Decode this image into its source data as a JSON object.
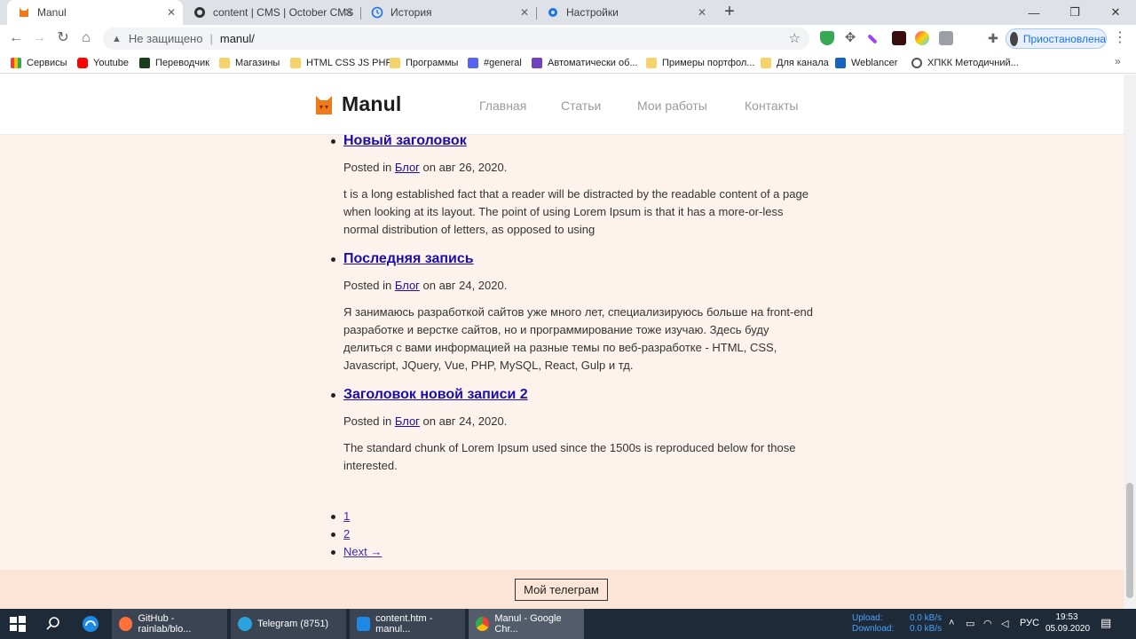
{
  "browser": {
    "tabs": [
      {
        "title": "Manul",
        "active": true
      },
      {
        "title": "content | CMS | October CMS",
        "active": false
      },
      {
        "title": "История",
        "active": false
      },
      {
        "title": "Настройки",
        "active": false
      }
    ],
    "address": {
      "security_label": "Не защищено",
      "url": "manul/"
    },
    "profile_label": "Приостановлена",
    "bookmarks": [
      "Сервисы",
      "Youtube",
      "Переводчик",
      "Магазины",
      "HTML CSS JS PHP",
      "Программы",
      "#general",
      "Автоматически об...",
      "Примеры портфол...",
      "Для канала",
      "Weblancer",
      "ХПКК Методичний..."
    ]
  },
  "site": {
    "logo": "Manul",
    "nav": [
      "Главная",
      "Статьи",
      "Мои работы",
      "Контакты"
    ],
    "posts": [
      {
        "title": "Новый заголовок",
        "meta_prefix": "Posted in",
        "category": "Блог",
        "meta_suffix": "on авг 26, 2020.",
        "excerpt": "t is a long established fact that a reader will be distracted by the readable content of a page when looking at its layout. The point of using Lorem Ipsum is that it has a more-or-less normal distribution of letters, as opposed to using"
      },
      {
        "title": "Последняя запись",
        "meta_prefix": "Posted in",
        "category": "Блог",
        "meta_suffix": "on авг 24, 2020.",
        "excerpt": "Я занимаюсь разработкой сайтов уже много лет, специализируюсь больше на front-end разработке и верстке сайтов, но и программирование тоже изучаю. Здесь буду делиться с вами информацией на разные темы по веб-разработке - HTML, CSS, Javascript, JQuery, Vue, PHP, MySQL, React, Gulp и тд."
      },
      {
        "title": "Заголовок новой записи 2",
        "meta_prefix": "Posted in",
        "category": "Блог",
        "meta_suffix": "on авг 24, 2020.",
        "excerpt": "The standard chunk of Lorem Ipsum used since the 1500s is reproduced below for those interested."
      }
    ],
    "pagination": [
      "1",
      "2",
      "Next →"
    ],
    "footer_button": "Мой телеграм"
  },
  "taskbar": {
    "apps": [
      "GitHub - rainlab/blo...",
      "Telegram (8751)",
      "content.htm - manul...",
      "Manul - Google Chr..."
    ],
    "upload_label": "Upload:",
    "upload_value": "0.0 kB/s",
    "download_label": "Download:",
    "download_value": "0.0 kB/s",
    "language": "РУС",
    "time": "19:53",
    "date": "05.09.2020"
  },
  "colors": {
    "page_bg": "#fdf3ec",
    "footer_bg": "#fce5d6",
    "link": "#1a0dab",
    "logo_orange": "#f07a1a"
  }
}
